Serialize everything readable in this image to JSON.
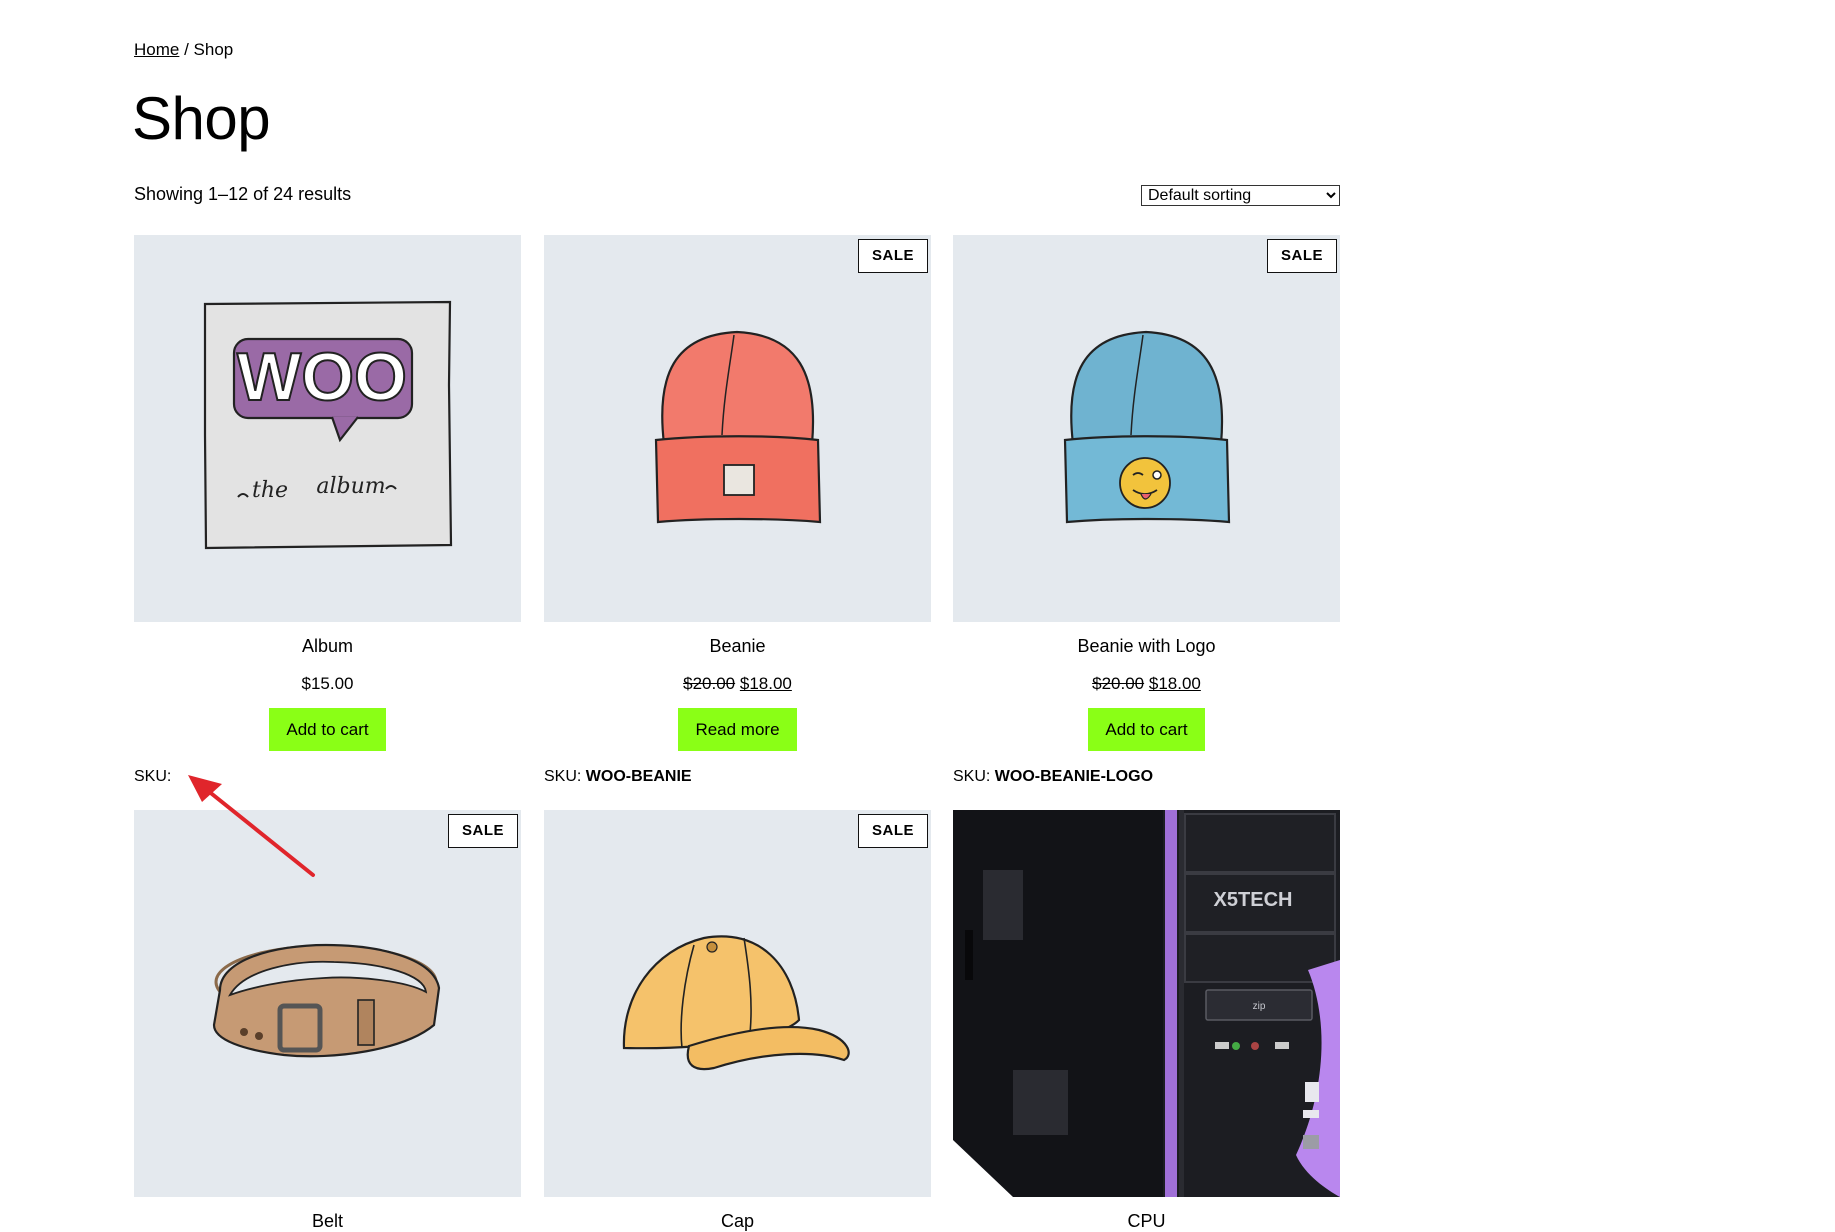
{
  "breadcrumb": {
    "home": "Home",
    "separator": " / ",
    "current": "Shop"
  },
  "page_title": "Shop",
  "result_count": "Showing 1–12 of 24 results",
  "sorting": {
    "selected": "Default sorting"
  },
  "products": [
    {
      "name": "Album",
      "price": "$15.00",
      "regular_price": "",
      "sale_price": "",
      "on_sale": false,
      "button": "Add to cart",
      "sku_label": "SKU:",
      "sku_value": "",
      "badge": ""
    },
    {
      "name": "Beanie",
      "price": "",
      "regular_price": "$20.00",
      "sale_price": "$18.00",
      "on_sale": true,
      "button": "Read more",
      "sku_label": "SKU:",
      "sku_value": "WOO-BEANIE",
      "badge": "SALE"
    },
    {
      "name": "Beanie with Logo",
      "price": "",
      "regular_price": "$20.00",
      "sale_price": "$18.00",
      "on_sale": true,
      "button": "Add to cart",
      "sku_label": "SKU:",
      "sku_value": "WOO-BEANIE-LOGO",
      "badge": "SALE"
    },
    {
      "name": "Belt",
      "badge": "SALE"
    },
    {
      "name": "Cap",
      "badge": "SALE"
    },
    {
      "name": "CPU",
      "badge": ""
    }
  ],
  "album_art": {
    "logo_text": "WOO",
    "caption_left": "the",
    "caption_right": "album"
  },
  "cpu_art": {
    "brand": "X5TECH",
    "drive_label": "zip"
  },
  "colors": {
    "button": "#8aff16",
    "thumb_bg": "#e4e9ee",
    "annotation": "#e0252b"
  }
}
